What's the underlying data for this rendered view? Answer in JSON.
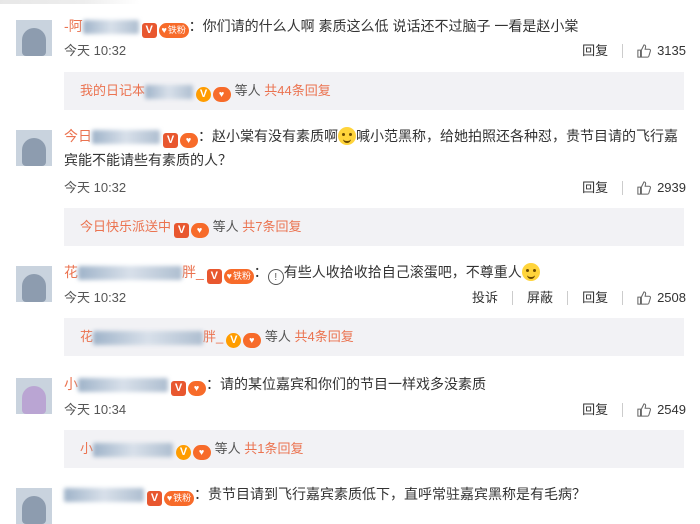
{
  "comments": [
    {
      "user": "-阿",
      "text": "你们请的什么人啊 素质这么低 说话还不过脑子 一看是赵小棠",
      "time": "今天 10:32",
      "reply_label": "回复",
      "likes": "3135",
      "thread": {
        "names": "我的日记本",
        "suffix": "等人",
        "count": "共44条回复"
      }
    },
    {
      "user": "今日",
      "text_before": "赵小棠有没有素质啊",
      "text_after": "喊小范黑称，给她拍照还各种怼，贵节目请的飞行嘉宾能不能请些有素质的人？",
      "time": "今天 10:32",
      "reply_label": "回复",
      "likes": "2939",
      "thread": {
        "names": "今日快乐派送中",
        "suffix": "等人",
        "count": "共7条回复"
      }
    },
    {
      "user": "花",
      "user_tail": "胖_",
      "text": "有些人收拾收拾自己滚蛋吧，不尊重人",
      "time": "今天 10:32",
      "report_label": "投诉",
      "block_label": "屏蔽",
      "reply_label": "回复",
      "likes": "2508",
      "thread": {
        "names": "花",
        "names_tail": "胖_",
        "suffix": "等人",
        "count": "共4条回复"
      }
    },
    {
      "user": "小",
      "text": "请的某位嘉宾和你们的节目一样戏多没素质",
      "time": "今天 10:34",
      "reply_label": "回复",
      "likes": "2549",
      "thread": {
        "names": "小",
        "suffix": "等人",
        "count": "共1条回复"
      }
    },
    {
      "user": "",
      "text": "贵节目请到飞行嘉宾素质低下，直呼常驻嘉宾黑称是有毛病？"
    }
  ],
  "badges": {
    "v": "V",
    "fan": "铁粉"
  },
  "colors": {
    "accent": "#eb7350",
    "reply_bg": "#f2f2f5"
  }
}
